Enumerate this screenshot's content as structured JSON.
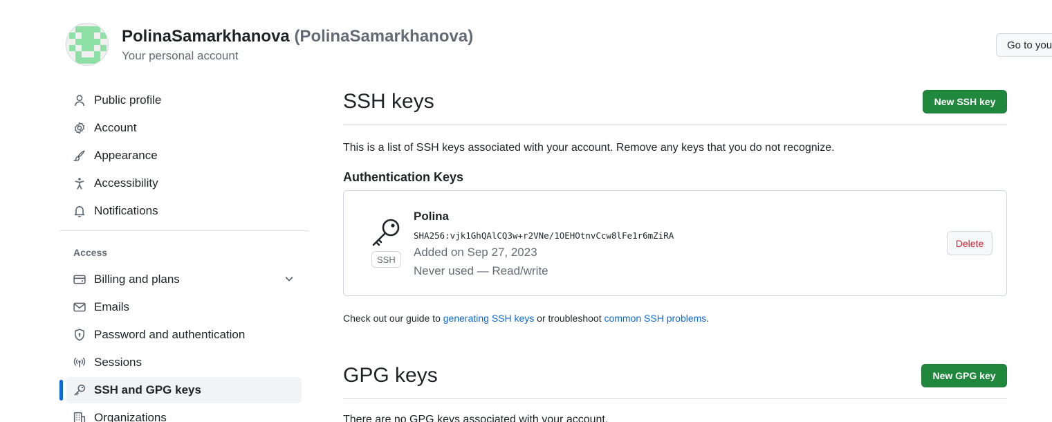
{
  "header": {
    "display_name": "PolinaSamarkhanova",
    "login": "(PolinaSamarkhanova)",
    "subtitle": "Your personal account",
    "go_to_profile_label": "Go to your personal profile"
  },
  "sidebar": {
    "items": [
      {
        "label": "Public profile",
        "icon": "person-icon"
      },
      {
        "label": "Account",
        "icon": "gear-icon"
      },
      {
        "label": "Appearance",
        "icon": "paintbrush-icon"
      },
      {
        "label": "Accessibility",
        "icon": "accessibility-icon"
      },
      {
        "label": "Notifications",
        "icon": "bell-icon"
      }
    ],
    "access_heading": "Access",
    "access_items": [
      {
        "label": "Billing and plans",
        "icon": "credit-card-icon"
      },
      {
        "label": "Emails",
        "icon": "mail-icon"
      },
      {
        "label": "Password and authentication",
        "icon": "shield-lock-icon"
      },
      {
        "label": "Sessions",
        "icon": "broadcast-icon"
      },
      {
        "label": "SSH and GPG keys",
        "icon": "key-icon",
        "active": true
      },
      {
        "label": "Organizations",
        "icon": "organization-icon"
      }
    ]
  },
  "ssh": {
    "title": "SSH keys",
    "new_button": "New SSH key",
    "description": "This is a list of SSH keys associated with your account. Remove any keys that you do not recognize.",
    "auth_heading": "Authentication Keys",
    "key": {
      "title": "Polina",
      "fingerprint": "SHA256:vjk1GhQAlCQ3w+r2VNe/1OEHOtnvCcw8lFe1r6mZiRA",
      "added": "Added on Sep 27, 2023",
      "usage": "Never used — Read/write",
      "badge": "SSH",
      "delete_label": "Delete"
    },
    "guide": {
      "prefix": "Check out our guide to ",
      "link1": "generating SSH keys",
      "middle": " or troubleshoot ",
      "link2": "common SSH problems",
      "suffix": "."
    }
  },
  "gpg": {
    "title": "GPG keys",
    "new_button": "New GPG key",
    "empty_text": "There are no GPG keys associated with your account."
  },
  "colors": {
    "primary_button": "#1f883d",
    "link": "#0969da",
    "danger": "#cf222e",
    "active_indicator": "#0969da"
  }
}
